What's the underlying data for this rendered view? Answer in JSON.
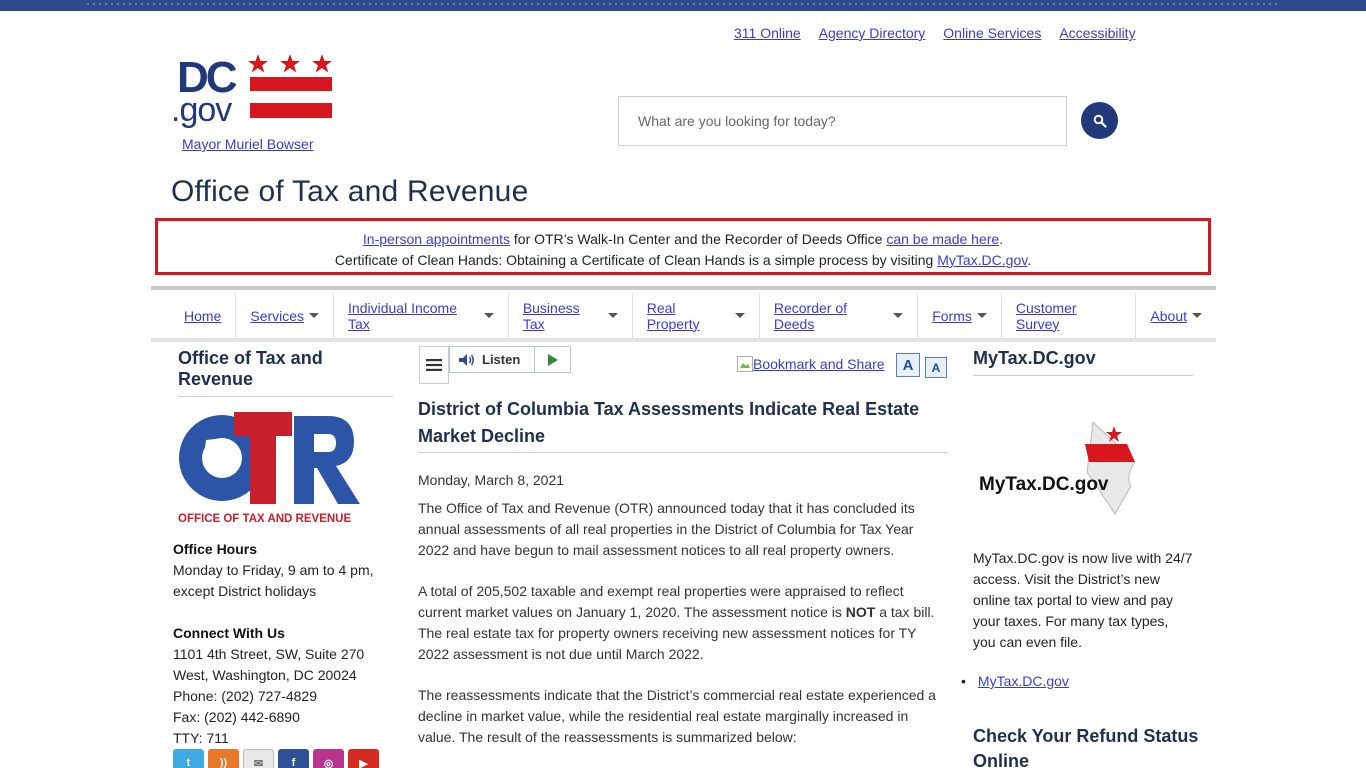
{
  "utility_links": [
    "311 Online",
    "Agency Directory",
    "Online Services",
    "Accessibility"
  ],
  "logo": {
    "text_dc": "DC",
    "text_gov": ".gov"
  },
  "mayor_link": "Mayor Muriel Bowser",
  "search": {
    "placeholder": "What are you looking for today?"
  },
  "site_title": "Office of Tax and Revenue",
  "alert": {
    "line1_link1": "In-person appointments",
    "line1_text": " for OTR’s Walk-In Center and the Recorder of Deeds Office ",
    "line1_link2": "can be made here",
    "line1_end": ".",
    "line2_text": "Certificate of Clean Hands: Obtaining a Certificate of Clean Hands is a simple process by visiting ",
    "line2_link": "MyTax.DC.gov",
    "line2_end": "."
  },
  "nav": [
    {
      "label": "Home",
      "dropdown": false
    },
    {
      "label": "Services",
      "dropdown": true
    },
    {
      "label": "Individual Income Tax",
      "dropdown": true
    },
    {
      "label": "Business Tax",
      "dropdown": true
    },
    {
      "label": "Real Property",
      "dropdown": true
    },
    {
      "label": "Recorder of Deeds",
      "dropdown": true
    },
    {
      "label": "Forms",
      "dropdown": true
    },
    {
      "label": "Customer Survey",
      "dropdown": false
    },
    {
      "label": "About",
      "dropdown": true
    }
  ],
  "left_sidebar": {
    "heading": "Office of Tax and Revenue",
    "otr_logo_caption": "OFFICE OF TAX AND REVENUE",
    "office_hours_title": "Office Hours",
    "office_hours_text": "Monday to Friday, 9 am to 4 pm, except District holidays",
    "connect_title": "Connect With Us",
    "address_line1": "1101 4th Street, SW, Suite 270",
    "address_line2": "West, Washington, DC 20024",
    "phone": "Phone: (202) 727-4829",
    "fax": "Fax: (202) 442-6890",
    "tty": "TTY: 711",
    "social": [
      "twitter-icon",
      "rss-icon",
      "email-icon",
      "facebook-icon",
      "instagram-icon",
      "youtube-icon"
    ]
  },
  "toolbar": {
    "listen_label": "Listen",
    "bookmark_label": "Bookmark and Share",
    "font_up": "A",
    "font_down": "A"
  },
  "article": {
    "title": "District of Columbia Tax Assessments Indicate Real Estate Market Decline",
    "date": "Monday, March 8, 2021",
    "p1": "The Office of Tax and Revenue (OTR) announced today that it has concluded its annual assessments of all real properties in the District of Columbia for Tax Year 2022 and have begun to mail assessment notices to all real property owners.",
    "p2_before": "A total of 205,502 taxable and exempt real properties were appraised to reflect current market values on January 1, 2020. The assessment notice is ",
    "p2_bold": "NOT",
    "p2_after": " a tax bill. The real estate tax for property owners receiving new assessment notices for TY 2022 assessment is not due until March 2022.",
    "p3": "The reassessments indicate that the District’s commercial real estate experienced a decline in market value, while the residential real estate marginally increased in value. The result of the reassessments is summarized below:"
  },
  "right_sidebar": {
    "heading": "MyTax.DC.gov",
    "logo_text": "MyTax.DC.gov",
    "text": "MyTax.DC.gov is now live with 24/7 access. Visit the District’s new online tax portal to view and pay your taxes. For many tax types, you can even file.",
    "link": "MyTax.DC.gov",
    "refund_heading": "Check Your Refund Status Online"
  },
  "colors": {
    "brand_navy": "#21397a",
    "dc_red": "#d7161e",
    "link": "#3b3bd4"
  }
}
